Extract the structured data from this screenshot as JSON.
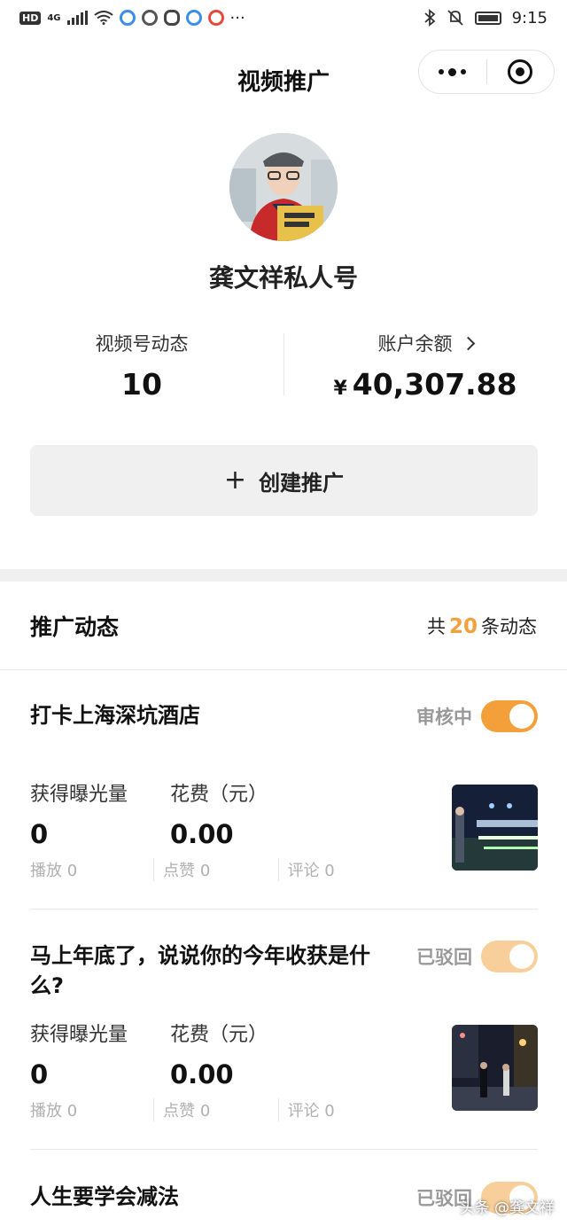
{
  "status_bar": {
    "network": "4G",
    "hd_label": "HD",
    "time": "9:15",
    "more": "···"
  },
  "nav": {
    "title": "视频推广"
  },
  "profile": {
    "name": "龚文祥私人号"
  },
  "stats": {
    "dynamics_label": "视频号动态",
    "dynamics_value": "10",
    "balance_label": "账户余额",
    "currency": "¥",
    "balance_value": "40,307.88"
  },
  "create_button": {
    "icon": "+",
    "label": "创建推广"
  },
  "section": {
    "title": "推广动态",
    "count_prefix": "共",
    "count_value": "20",
    "count_suffix": "条动态"
  },
  "promotions": [
    {
      "title": "打卡上海深坑酒店",
      "status": "审核中",
      "toggle_on": true,
      "exposure_label": "获得曝光量",
      "exposure_value": "0",
      "cost_label": "花费（元）",
      "cost_value": "0.00",
      "plays": "播放 0",
      "likes": "点赞 0",
      "comments": "评论 0"
    },
    {
      "title": "马上年底了，说说你的今年收获是什么?",
      "status": "已驳回",
      "toggle_on": false,
      "exposure_label": "获得曝光量",
      "exposure_value": "0",
      "cost_label": "花费（元）",
      "cost_value": "0.00",
      "plays": "播放 0",
      "likes": "点赞 0",
      "comments": "评论 0"
    },
    {
      "title": "人生要学会减法",
      "status": "已驳回",
      "toggle_on": false
    }
  ],
  "watermark": "头条 @龚文祥",
  "colors": {
    "accent": "#f3a03b",
    "accent_dim": "#f8cf9a",
    "count_highlight": "#f2a13c",
    "button_bg": "#f0f0f0"
  }
}
